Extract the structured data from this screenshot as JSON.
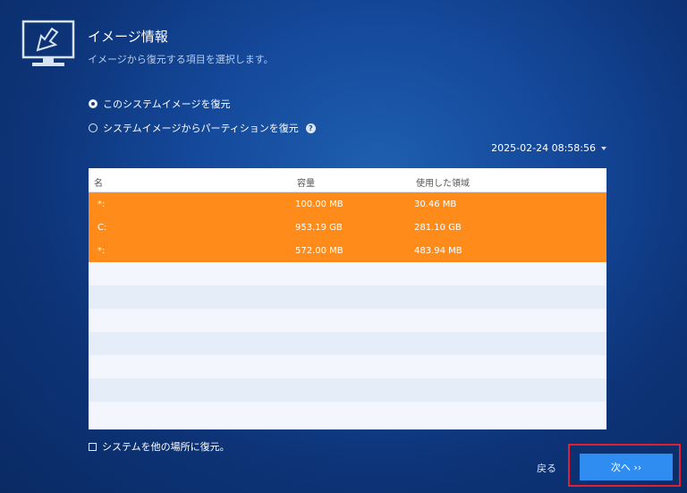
{
  "header": {
    "title": "イメージ情報",
    "subtitle": "イメージから復元する項目を選択します。"
  },
  "options": {
    "restore_system_image": "このシステムイメージを復元",
    "restore_partition": "システムイメージからパーティションを復元",
    "help_glyph": "?"
  },
  "backup_date": {
    "selected": "2025-02-24 08:58:56"
  },
  "table": {
    "columns": [
      "名",
      "容量",
      "使用した領域"
    ],
    "rows": [
      {
        "name": "*:",
        "capacity": "100.00 MB",
        "used": "30.46 MB"
      },
      {
        "name": "C:",
        "capacity": "953.19 GB",
        "used": "281.10 GB"
      },
      {
        "name": "*:",
        "capacity": "572.00 MB",
        "used": "483.94 MB"
      }
    ]
  },
  "other_location": {
    "label": "システムを他の場所に復元。"
  },
  "footer": {
    "back_label": "戻る",
    "next_label": "次へ ››"
  },
  "colors": {
    "selection": "#ff8c1a",
    "next_button": "#2f8cf0",
    "highlight_frame": "#e02030"
  },
  "icons": {
    "header": "monitor-restore-icon",
    "help": "help-icon",
    "dropdown": "caret-down-icon"
  }
}
